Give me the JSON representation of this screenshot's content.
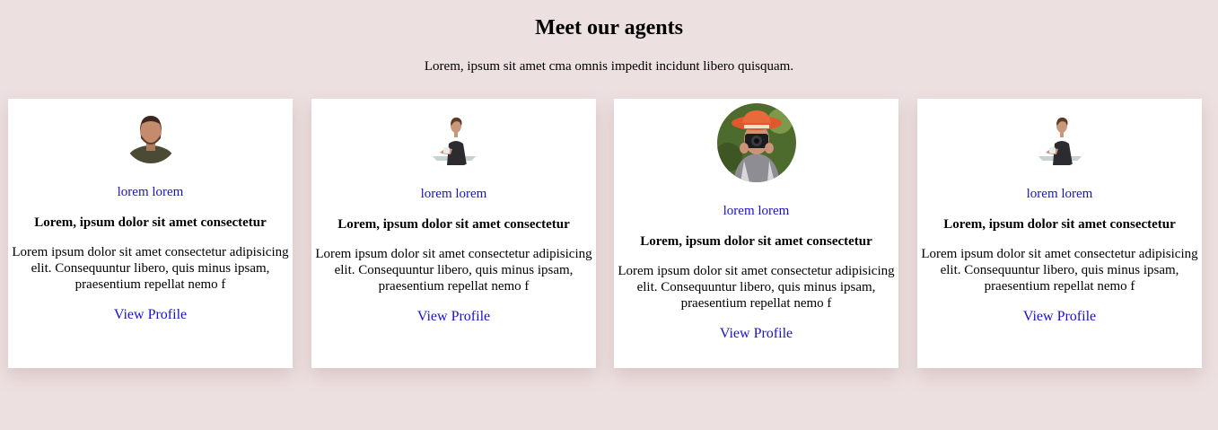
{
  "header": {
    "title": "Meet our agents",
    "subtitle": "Lorem, ipsum sit amet cma omnis impedit incidunt libero quisquam."
  },
  "agents": [
    {
      "avatar_icon": "man-portrait-avatar",
      "name": "lorem lorem",
      "headline": "Lorem, ipsum dolor sit amet consectetur",
      "description": "Lorem ipsum dolor sit amet consectetur adipisicing elit. Consequuntur libero, quis minus ipsam, praesentium repellat nemo f",
      "link_label": "View Profile"
    },
    {
      "avatar_icon": "woman-coffee-avatar",
      "name": "lorem lorem",
      "headline": "Lorem, ipsum dolor sit amet consectetur",
      "description": "Lorem ipsum dolor sit amet consectetur adipisicing elit. Consequuntur libero, quis minus ipsam, praesentium repellat nemo f",
      "link_label": "View Profile"
    },
    {
      "avatar_icon": "photographer-avatar",
      "name": "lorem lorem",
      "headline": "Lorem, ipsum dolor sit amet consectetur",
      "description": "Lorem ipsum dolor sit amet consectetur adipisicing elit. Consequuntur libero, quis minus ipsam, praesentium repellat nemo f",
      "link_label": "View Profile"
    },
    {
      "avatar_icon": "woman-coffee-avatar",
      "name": "lorem lorem",
      "headline": "Lorem, ipsum dolor sit amet consectetur",
      "description": "Lorem ipsum dolor sit amet consectetur adipisicing elit. Consequuntur libero, quis minus ipsam, praesentium repellat nemo f",
      "link_label": "View Profile"
    }
  ],
  "colors": {
    "background": "#ede0e0",
    "card": "#ffffff",
    "link": "#1a12c9"
  }
}
